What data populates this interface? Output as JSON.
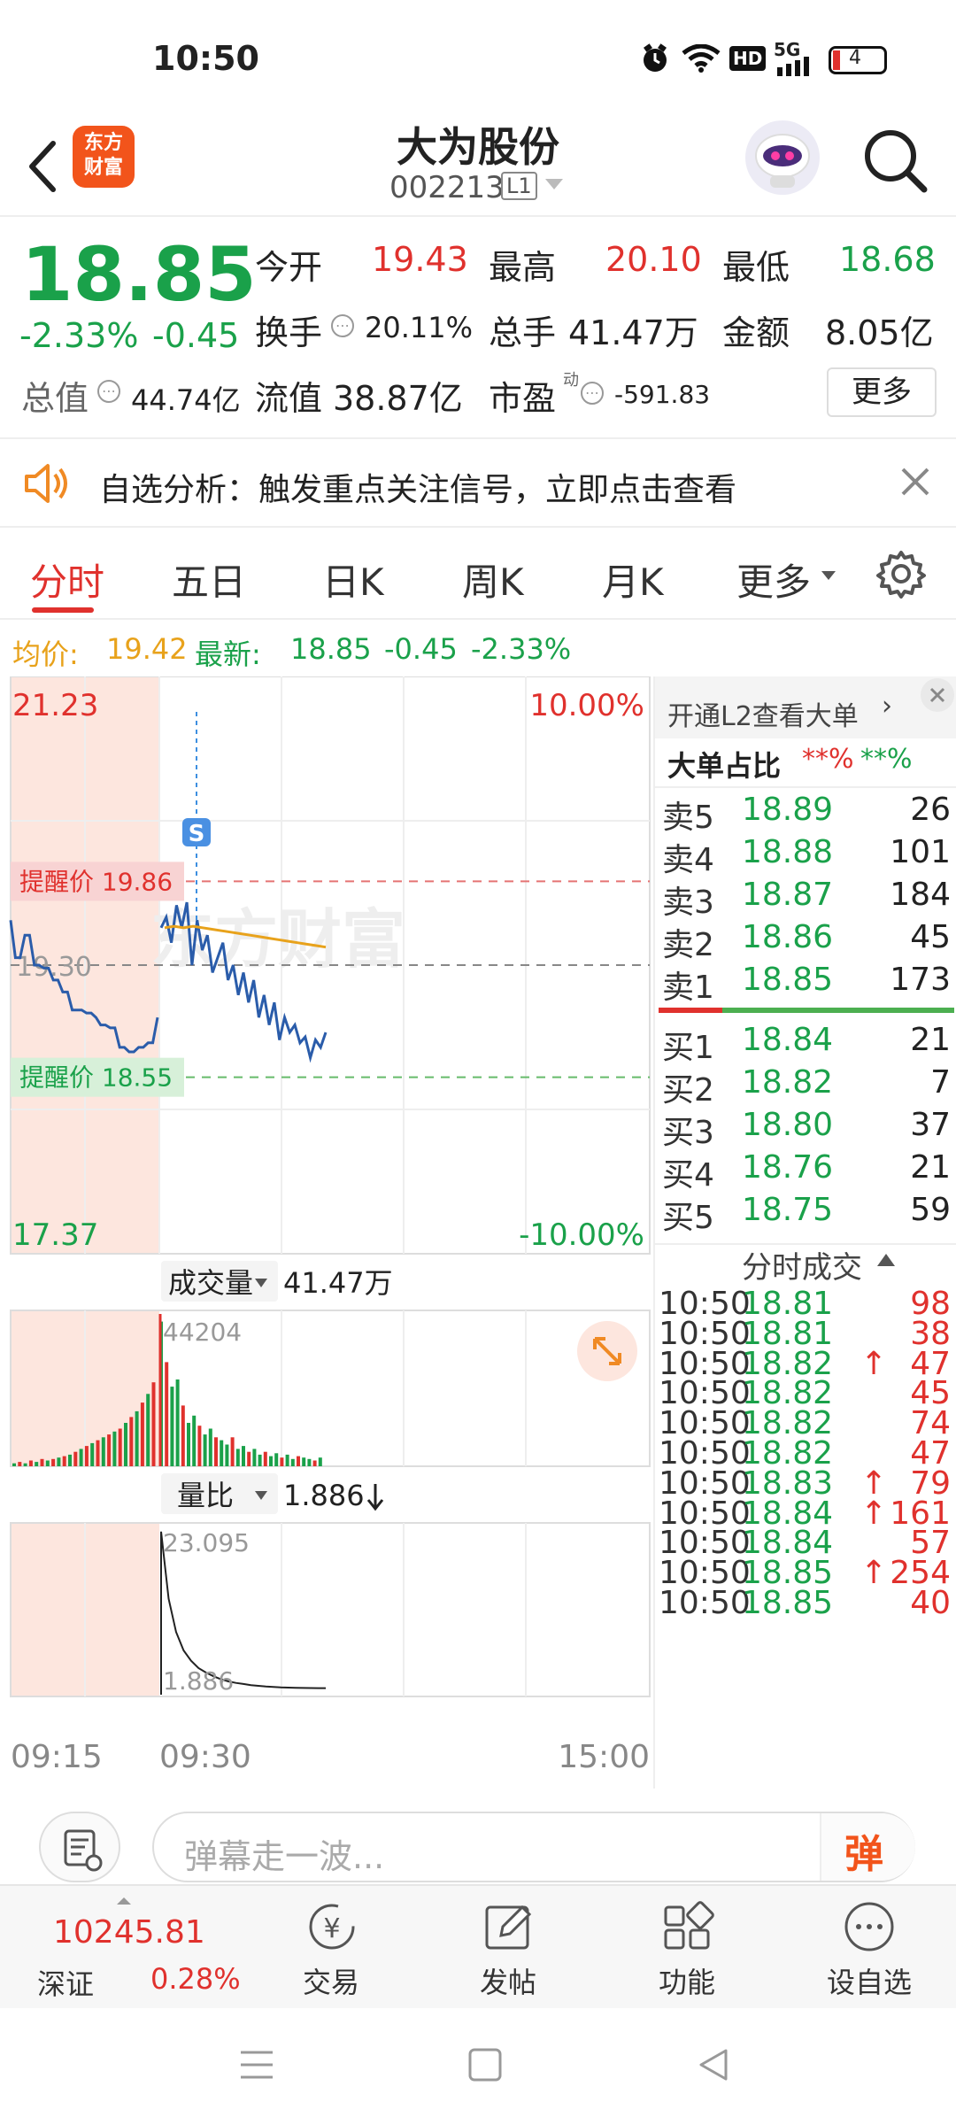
{
  "status": {
    "time": "10:50",
    "battery": "4",
    "hd": "HD",
    "net": "5G"
  },
  "header": {
    "title": "大为股份",
    "code": "002213",
    "level": "L1",
    "logo_line1": "东方",
    "logo_line2": "财富"
  },
  "quote": {
    "price": "18.85",
    "pct": "-2.33%",
    "chg": "-0.45",
    "open_label": "今开",
    "open": "19.43",
    "high_label": "最高",
    "high": "20.10",
    "low_label": "最低",
    "low": "18.68",
    "turnover_label": "换手",
    "turnover": "20.11%",
    "volume_label": "总手",
    "volume": "41.47万",
    "amount_label": "金额",
    "amount": "8.05亿",
    "mcap_label": "总值",
    "mcap": "44.74亿",
    "float_label": "流值",
    "float": "38.87亿",
    "pe_label": "市盈",
    "pe_sup": "动",
    "pe": "-591.83",
    "more": "更多"
  },
  "notice": {
    "text": "自选分析：触发重点关注信号，立即点击查看"
  },
  "tabs": [
    "分时",
    "五日",
    "日K",
    "周K",
    "月K",
    "更多"
  ],
  "legend": {
    "avg_label": "均价:",
    "avg": "19.42",
    "latest_label": "最新:",
    "latest": "18.85",
    "chg": "-0.45",
    "pct": "-2.33%"
  },
  "chart_labels": {
    "top_price": "21.23",
    "top_pct": "10.00%",
    "bottom_price": "17.37",
    "bottom_pct": "-10.00%",
    "mid_price": "19.30",
    "alert_high": "提醒价 19.86",
    "alert_low": "提醒价 18.55",
    "s_marker": "S",
    "watermark": "东方财富",
    "vol_label": "成交量",
    "vol_total": "41.47万",
    "vol_max": "44204",
    "ratio_label": "量比",
    "ratio_val": "1.886",
    "ratio_top": "23.095",
    "ratio_last": "1.886",
    "time_start": "09:15",
    "time_mid": "09:30",
    "time_end": "15:00"
  },
  "chart_data": {
    "type": "line",
    "ylim": [
      17.37,
      21.23
    ],
    "prev_close": 19.3,
    "alerts": [
      19.86,
      18.55
    ],
    "price_preopen": [
      19.6,
      19.35,
      19.35,
      19.5,
      19.5,
      19.3,
      19.3,
      19.28,
      19.28,
      19.2,
      19.2,
      19.12,
      19.12,
      19.0,
      19.0,
      19.0,
      18.98,
      18.98,
      18.95,
      18.9,
      18.9,
      18.88,
      18.88,
      18.75,
      18.75,
      18.72,
      18.72,
      18.75,
      18.75,
      18.78,
      18.78,
      18.95
    ],
    "price": [
      19.55,
      19.62,
      19.45,
      19.7,
      19.55,
      19.72,
      19.3,
      19.6,
      19.4,
      19.5,
      19.25,
      19.35,
      19.45,
      19.2,
      19.3,
      19.1,
      19.25,
      19.05,
      19.2,
      18.95,
      19.1,
      18.9,
      19.05,
      18.8,
      18.95,
      18.85,
      18.9,
      18.78,
      18.82,
      18.68,
      18.8,
      18.75,
      18.85
    ],
    "avg": [
      19.55,
      19.56,
      19.55,
      19.56,
      19.55,
      19.54,
      19.53,
      19.52,
      19.51,
      19.5,
      19.49,
      19.48,
      19.47,
      19.46,
      19.45,
      19.44,
      19.43,
      19.42
    ],
    "volume_preopen": [
      0.02,
      0.03,
      0.02,
      0.04,
      0.03,
      0.05,
      0.04,
      0.05,
      0.06,
      0.07,
      0.08,
      0.1,
      0.12,
      0.14,
      0.16,
      0.18,
      0.2,
      0.22,
      0.24,
      0.26,
      0.3,
      0.34,
      0.38,
      0.44,
      0.5,
      0.58
    ],
    "volume": [
      1.0,
      0.72,
      0.55,
      0.6,
      0.42,
      0.3,
      0.35,
      0.28,
      0.22,
      0.26,
      0.2,
      0.18,
      0.15,
      0.2,
      0.12,
      0.14,
      0.1,
      0.12,
      0.08,
      0.1,
      0.07,
      0.09,
      0.06,
      0.08,
      0.05,
      0.07,
      0.06,
      0.05,
      0.04,
      0.06
    ],
    "volume_ratio": [
      23.095,
      14.0,
      9.5,
      7.0,
      5.6,
      4.6,
      4.0,
      3.5,
      3.1,
      2.8,
      2.6,
      2.45,
      2.3,
      2.2,
      2.1,
      2.05,
      2.0,
      1.96,
      1.93,
      1.91,
      1.9,
      1.89,
      1.886
    ]
  },
  "orderbook": {
    "header": "开通L2查看大单",
    "big_label": "大单占比",
    "big_red": "**%",
    "big_green": "**%",
    "asks": [
      {
        "label": "卖5",
        "price": "18.89",
        "vol": "26"
      },
      {
        "label": "卖4",
        "price": "18.88",
        "vol": "101"
      },
      {
        "label": "卖3",
        "price": "18.87",
        "vol": "184"
      },
      {
        "label": "卖2",
        "price": "18.86",
        "vol": "45"
      },
      {
        "label": "卖1",
        "price": "18.85",
        "vol": "173"
      }
    ],
    "bids": [
      {
        "label": "买1",
        "price": "18.84",
        "vol": "21"
      },
      {
        "label": "买2",
        "price": "18.82",
        "vol": "7"
      },
      {
        "label": "买3",
        "price": "18.80",
        "vol": "37"
      },
      {
        "label": "买4",
        "price": "18.76",
        "vol": "21"
      },
      {
        "label": "买5",
        "price": "18.75",
        "vol": "59"
      }
    ]
  },
  "trades": {
    "title": "分时成交",
    "rows": [
      {
        "time": "10:50",
        "price": "18.81",
        "up": "",
        "vol": "98"
      },
      {
        "time": "10:50",
        "price": "18.81",
        "up": "",
        "vol": "38"
      },
      {
        "time": "10:50",
        "price": "18.82",
        "up": "↑",
        "vol": "47"
      },
      {
        "time": "10:50",
        "price": "18.82",
        "up": "",
        "vol": "45"
      },
      {
        "time": "10:50",
        "price": "18.82",
        "up": "",
        "vol": "74"
      },
      {
        "time": "10:50",
        "price": "18.82",
        "up": "",
        "vol": "47"
      },
      {
        "time": "10:50",
        "price": "18.83",
        "up": "↑",
        "vol": "79"
      },
      {
        "time": "10:50",
        "price": "18.84",
        "up": "↑",
        "vol": "161"
      },
      {
        "time": "10:50",
        "price": "18.84",
        "up": "",
        "vol": "57"
      },
      {
        "time": "10:50",
        "price": "18.85",
        "up": "↑",
        "vol": "254"
      },
      {
        "time": "10:50",
        "price": "18.85",
        "up": "",
        "vol": "40"
      }
    ]
  },
  "comment": {
    "placeholder": "弹幕走一波...",
    "danmu": "弹"
  },
  "bottom": {
    "index_value": "10245.81",
    "index_name": "深证",
    "index_pct": "0.28%",
    "trade": "交易",
    "post": "发帖",
    "func": "功能",
    "watch": "设自选"
  },
  "colors": {
    "red": "#e0312d",
    "green": "#1aa14a",
    "orange": "#e8a21b",
    "line": "#2a5caa"
  }
}
